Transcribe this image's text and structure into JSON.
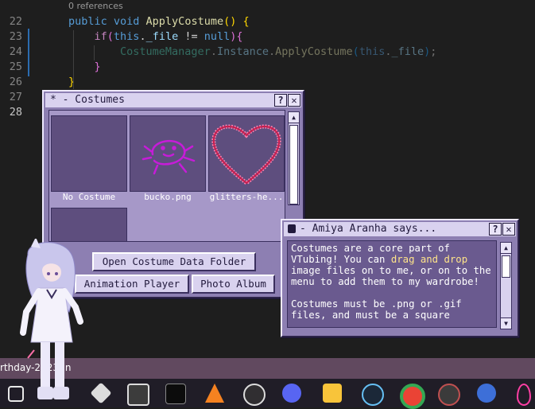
{
  "editor": {
    "codelens": "0 references",
    "lines": [
      {
        "num": "22",
        "tokens": [
          {
            "t": "public ",
            "c": "kw2"
          },
          {
            "t": "void ",
            "c": "kw2"
          },
          {
            "t": "ApplyCostume",
            "c": "fn"
          },
          {
            "t": "() ",
            "c": "br1"
          },
          {
            "t": "{",
            "c": "br1"
          }
        ]
      },
      {
        "num": "23",
        "tokens": [
          {
            "t": "    if",
            "c": "kw"
          },
          {
            "t": "(",
            "c": "br2"
          },
          {
            "t": "this",
            "c": "kw2"
          },
          {
            "t": ".",
            "c": "pl"
          },
          {
            "t": "_file",
            "c": "var"
          },
          {
            "t": " != ",
            "c": "pl"
          },
          {
            "t": "null",
            "c": "kw2"
          },
          {
            "t": ")",
            "c": "br2"
          },
          {
            "t": "{",
            "c": "br2"
          }
        ]
      },
      {
        "num": "24",
        "tokens": [
          {
            "t": "        CostumeManager",
            "c": "ty"
          },
          {
            "t": ".",
            "c": "pl"
          },
          {
            "t": "Instance",
            "c": "var"
          },
          {
            "t": ".",
            "c": "pl"
          },
          {
            "t": "ApplyCostume",
            "c": "fn"
          },
          {
            "t": "(",
            "c": "br3"
          },
          {
            "t": "this",
            "c": "kw2"
          },
          {
            "t": ".",
            "c": "pl"
          },
          {
            "t": "_file",
            "c": "var"
          },
          {
            "t": ")",
            "c": "br3"
          },
          {
            "t": ";",
            "c": "pl"
          }
        ],
        "dim": true
      },
      {
        "num": "25",
        "tokens": [
          {
            "t": "    }",
            "c": "br2"
          }
        ]
      },
      {
        "num": "26",
        "tokens": [
          {
            "t": "}",
            "c": "br1"
          }
        ]
      },
      {
        "num": "27",
        "tokens": []
      },
      {
        "num": "28",
        "tokens": [],
        "active": true
      }
    ]
  },
  "costumes_window": {
    "title": "* - Costumes",
    "help_label": "?",
    "close_label": "✕",
    "items": [
      {
        "label": "No Costume"
      },
      {
        "label": "bucko.png"
      },
      {
        "label": "glitters-he..."
      },
      {
        "label": ""
      }
    ],
    "open_folder_label": "Open Costume Data Folder",
    "animation_player_label": "Animation Player",
    "photo_album_label": "Photo Album"
  },
  "speech_window": {
    "title": "- Amiya Aranha says...",
    "help_label": "?",
    "close_label": "✕",
    "p1_a": "Costumes are a core part of VTubing! You can ",
    "p1_hl": "drag and drop",
    "p1_b": " image files on to me, or on to the menu to add them to my wardrobe!",
    "p2": "Costumes must be .png or .gif files, and must be a square"
  },
  "statusbar": {
    "text": "rthday-2023-In"
  },
  "taskbar": {
    "icons": [
      "task-view-icon",
      "unity-icon",
      "unity-hub-icon",
      "terminal-icon",
      "vlc-icon",
      "obs-icon",
      "discord-icon",
      "file-explorer-icon",
      "steam-icon",
      "chrome-icon",
      "app-icon",
      "app-swirl-icon",
      "app-pink-icon"
    ]
  },
  "colors": {
    "window_bg": "#8d7fb2",
    "titlebar_bg": "#d9d2ef",
    "highlight": "#ffe48a",
    "statusbar": "#61495f",
    "taskbar": "#201d27"
  }
}
